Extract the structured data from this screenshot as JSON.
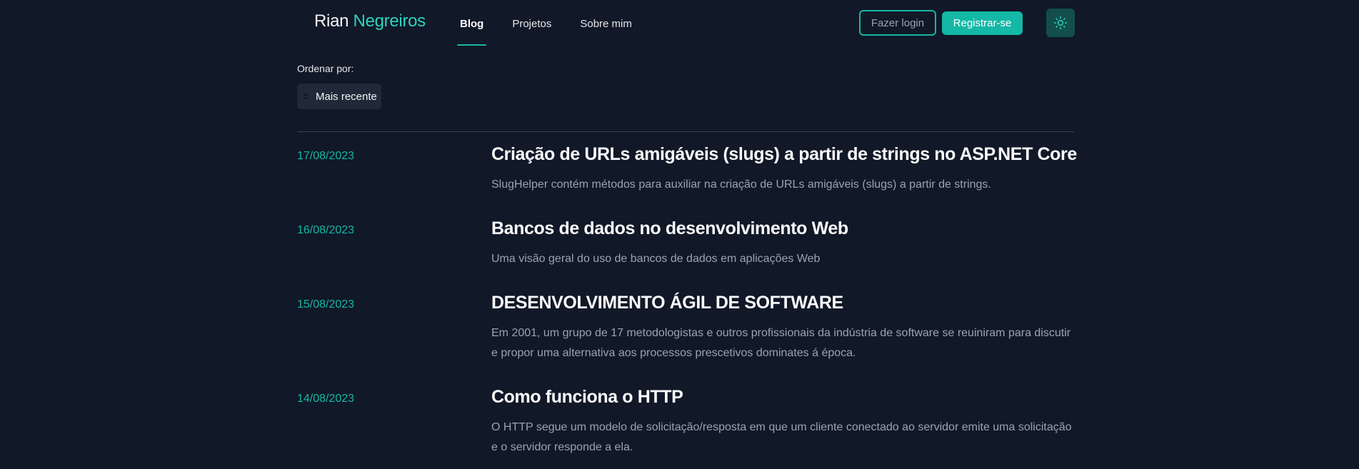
{
  "header": {
    "logo_first": "Rian",
    "logo_second": "Negreiros",
    "nav": [
      {
        "label": "Blog",
        "active": true
      },
      {
        "label": "Projetos",
        "active": false
      },
      {
        "label": "Sobre mim",
        "active": false
      }
    ],
    "login_label": "Fazer login",
    "register_label": "Registrar-se",
    "theme_icon": "sun-icon"
  },
  "sort": {
    "label": "Ordenar por:",
    "selected": "Mais recente"
  },
  "colors": {
    "background": "#111827",
    "accent": "#14b8a6",
    "text_muted": "#9ca3af"
  },
  "posts": [
    {
      "date": "17/08/2023",
      "title": "Criação de URLs amigáveis (slugs) a partir de strings no ASP.NET Core",
      "description": "SlugHelper contém métodos para auxiliar na criação de URLs amigáveis (slugs) a partir de strings."
    },
    {
      "date": "16/08/2023",
      "title": "Bancos de dados no desenvolvimento Web",
      "description": "Uma visão geral do uso de bancos de dados em aplicações Web"
    },
    {
      "date": "15/08/2023",
      "title": "DESENVOLVIMENTO ÁGIL DE SOFTWARE",
      "description": "Em 2001, um grupo de 17 metodologistas e outros profissionais da indústria de software se reuiniram para discutir e propor uma alternativa aos processos prescetivos dominates á época."
    },
    {
      "date": "14/08/2023",
      "title": "Como funciona o HTTP",
      "description": "O HTTP segue um modelo de solicitação/resposta em que um cliente conectado ao servidor emite uma solicitação e o servidor responde a ela."
    }
  ]
}
